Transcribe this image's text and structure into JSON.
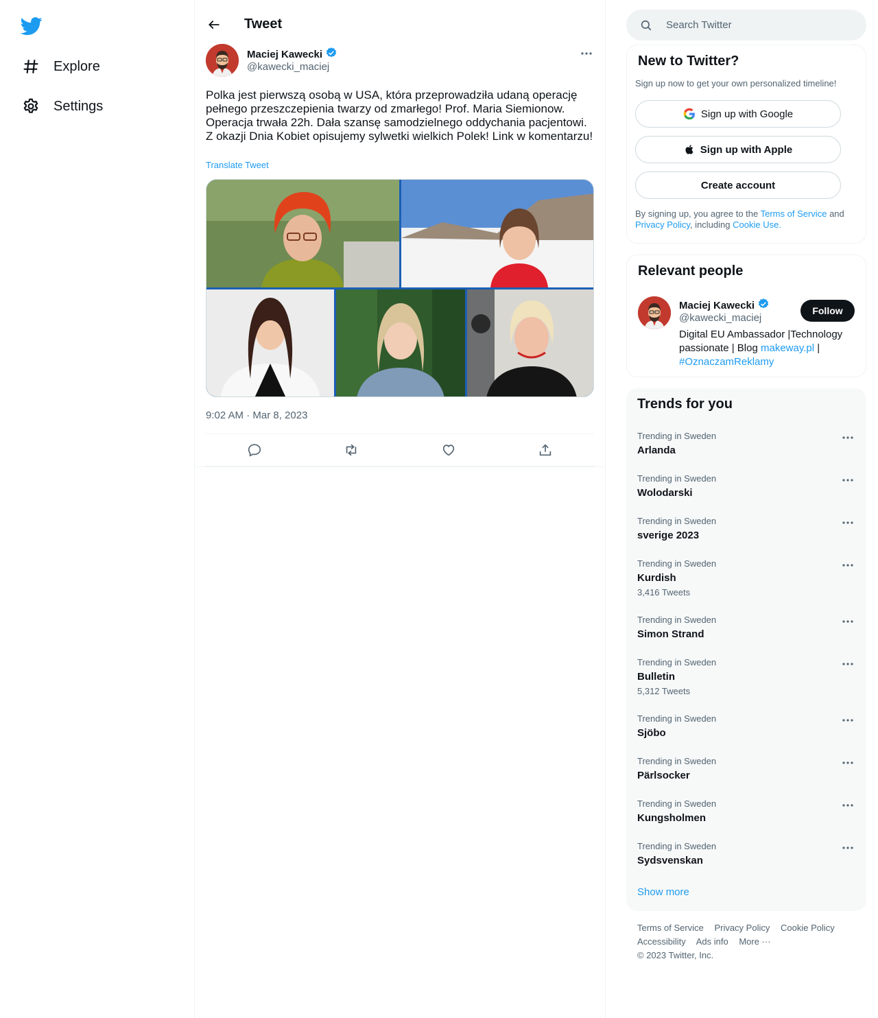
{
  "nav": {
    "explore_label": "Explore",
    "settings_label": "Settings"
  },
  "header": {
    "title": "Tweet"
  },
  "tweet": {
    "author_name": "Maciej Kawecki",
    "author_handle": "@kawecki_maciej",
    "text": "Polka jest pierwszą osobą w USA, która przeprowadziła udaną operację pełnego przeszczepienia twarzy od zmarłego! Prof. Maria Siemionow. Operacja trwała 22h. Dała szansę samodzielnego oddychania pacjentowi. Z okazji Dnia Kobiet opisujemy sylwetki wielkich Polek! Link w komentarzu!",
    "translate_label": "Translate Tweet",
    "timestamp": "9:02 AM · Mar 8, 2023"
  },
  "search": {
    "placeholder": "Search Twitter"
  },
  "signup": {
    "title": "New to Twitter?",
    "subtitle": "Sign up now to get your own personalized timeline!",
    "google_label": "Sign up with Google",
    "apple_label": "Sign up with Apple",
    "create_label": "Create account",
    "terms_prefix": "By signing up, you agree to the",
    "terms_link": "Terms of Service",
    "terms_and": "and",
    "privacy_link": "Privacy Policy",
    "including": ", including",
    "cookie_link": "Cookie Use."
  },
  "relevant": {
    "title": "Relevant people",
    "name": "Maciej Kawecki",
    "handle": "@kawecki_maciej",
    "follow_label": "Follow",
    "bio_text": "Digital EU Ambassador |Technology passionate | Blog",
    "bio_link": "makeway.pl",
    "bio_sep": "|",
    "bio_hashtag": "#OznaczamReklamy"
  },
  "trends": {
    "title": "Trends for you",
    "items": [
      {
        "context": "Trending in Sweden",
        "name": "Arlanda",
        "count": ""
      },
      {
        "context": "Trending in Sweden",
        "name": "Wolodarski",
        "count": ""
      },
      {
        "context": "Trending in Sweden",
        "name": "sverige 2023",
        "count": ""
      },
      {
        "context": "Trending in Sweden",
        "name": "Kurdish",
        "count": "3,416 Tweets"
      },
      {
        "context": "Trending in Sweden",
        "name": "Simon Strand",
        "count": ""
      },
      {
        "context": "Trending in Sweden",
        "name": "Bulletin",
        "count": "5,312 Tweets"
      },
      {
        "context": "Trending in Sweden",
        "name": "Sjöbo",
        "count": ""
      },
      {
        "context": "Trending in Sweden",
        "name": "Pärlsocker",
        "count": ""
      },
      {
        "context": "Trending in Sweden",
        "name": "Kungsholmen",
        "count": ""
      },
      {
        "context": "Trending in Sweden",
        "name": "Sydsvenskan",
        "count": ""
      }
    ],
    "show_more": "Show more"
  },
  "footer": {
    "terms": "Terms of Service",
    "privacy": "Privacy Policy",
    "cookie": "Cookie Policy",
    "accessibility": "Accessibility",
    "ads": "Ads info",
    "more": "More ···",
    "copyright": "© 2023 Twitter, Inc."
  },
  "colors": {
    "accent": "#1d9bf0",
    "text": "#0f1419",
    "secondary": "#536471",
    "verified": "#1d9bf0"
  }
}
